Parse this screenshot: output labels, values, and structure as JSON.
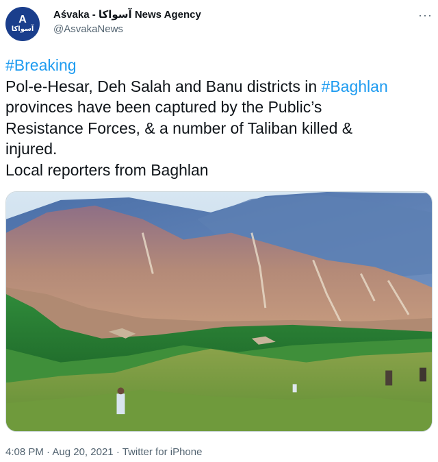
{
  "account": {
    "display_name": "Aśvaka - آسواکا News Agency",
    "handle": "@AsvakaNews",
    "avatar_text": "آسواکا",
    "avatar_mark": "A"
  },
  "more_label": "···",
  "tweet": {
    "lines": [
      {
        "text": "#Breaking",
        "hashtag": true
      },
      {
        "pre": "Pol-e-Hesar, Deh Salah and Banu districts in ",
        "tag": "#Baghlan"
      },
      {
        "text": "provinces have been captured by the Public’s"
      },
      {
        "text": "Resistance Forces, & a number of Taliban killed &"
      },
      {
        "text": "injured."
      },
      {
        "text": "Local reporters from Baghlan"
      }
    ]
  },
  "meta": {
    "time": "4:08 PM",
    "date": "Aug 20, 2021",
    "source": "Twitter for iPhone",
    "separator": "·"
  }
}
